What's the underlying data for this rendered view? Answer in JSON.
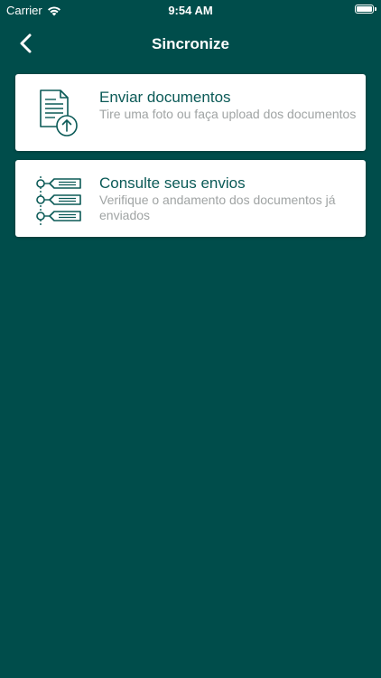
{
  "status_bar": {
    "carrier": "Carrier",
    "time": "9:54 AM",
    "wifi_icon": "wifi-icon",
    "battery_icon": "battery-icon"
  },
  "nav": {
    "title": "Sincronize",
    "back_icon": "chevron-left-icon"
  },
  "cards": [
    {
      "title": "Enviar documentos",
      "subtitle": "Tire uma foto ou faça upload dos documentos",
      "icon": "document-upload-icon"
    },
    {
      "title": "Consulte seus envios",
      "subtitle": "Verifique o andamento dos documentos já enviados",
      "icon": "timeline-list-icon"
    }
  ],
  "colors": {
    "background": "#004d4b",
    "accent": "#0b5a57",
    "card": "#ffffff",
    "subtitle": "#a0a4a4"
  }
}
